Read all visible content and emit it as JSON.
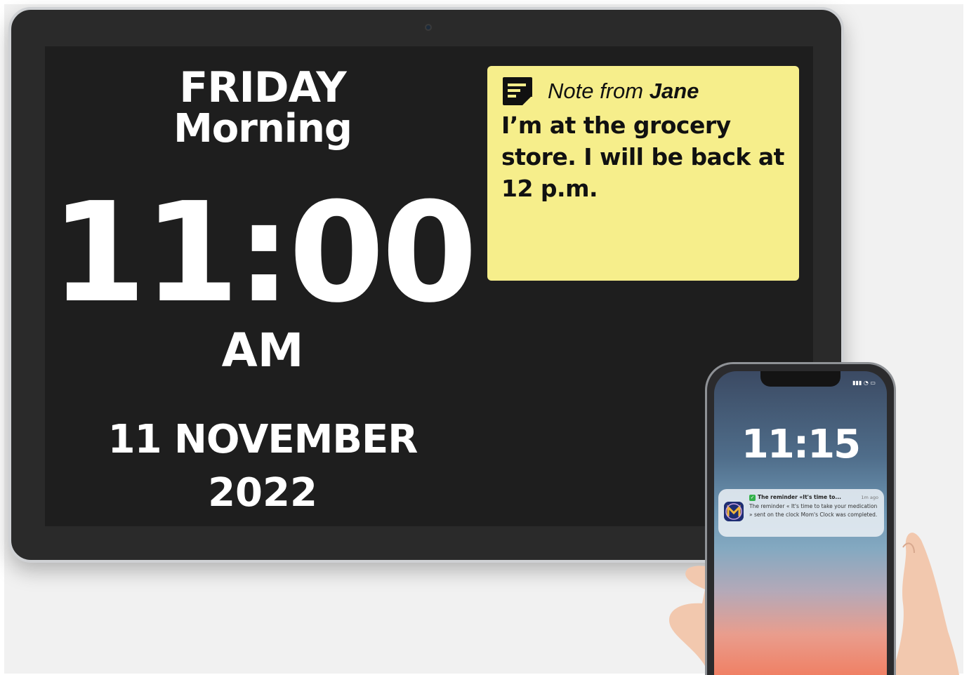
{
  "tablet": {
    "clock": {
      "day": "FRIDAY",
      "period": "Morning",
      "time": "11:00",
      "ampm": "AM",
      "date": "11 NOVEMBER",
      "year": "2022"
    },
    "note": {
      "icon": "note-icon",
      "title_prefix": "Note from ",
      "title_name": "Jane",
      "body": "I’m at the grocery store. I will be back at 12 p.m.",
      "background_color": "#f6ee8b"
    }
  },
  "phone": {
    "lock_time": "11:15",
    "notification": {
      "app_icon": "moms-clock-app-icon",
      "title": "The reminder «It's time to...",
      "ago": "1m ago",
      "body": "The reminder « It's time to take your medication » sent on the clock Mom's Clock was completed."
    }
  },
  "colors": {
    "screen": "#1e1e1e",
    "note": "#f6ee8b",
    "check": "#32b14a"
  }
}
